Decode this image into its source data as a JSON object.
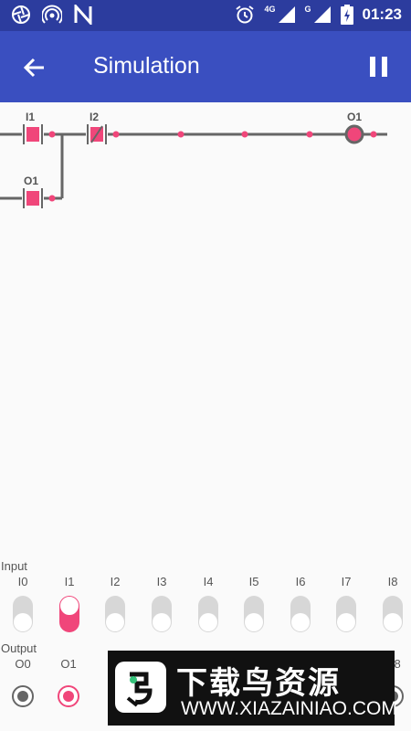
{
  "status_bar": {
    "time": "01:23",
    "net_label_1": "4G",
    "net_label_2": "G",
    "icons": [
      "aperture-icon",
      "hotspot-icon",
      "n-icon",
      "alarm-icon",
      "signal-icon",
      "battery-charging-icon"
    ]
  },
  "app_bar": {
    "title": "Simulation",
    "back_icon": "arrow-back-icon",
    "pause_icon": "pause-icon"
  },
  "ladder": {
    "rung1": {
      "contact1": "I1",
      "contact2": "I2",
      "coil": "O1"
    },
    "rung2": {
      "contact1": "O1"
    }
  },
  "inputs": {
    "label": "Input",
    "items": [
      {
        "name": "I0",
        "on": false
      },
      {
        "name": "I1",
        "on": true
      },
      {
        "name": "I2",
        "on": false
      },
      {
        "name": "I3",
        "on": false
      },
      {
        "name": "I4",
        "on": false
      },
      {
        "name": "I5",
        "on": false
      },
      {
        "name": "I6",
        "on": false
      },
      {
        "name": "I7",
        "on": false
      },
      {
        "name": "I8",
        "on": false
      }
    ]
  },
  "outputs": {
    "label": "Output",
    "items": [
      {
        "name": "O0",
        "on": false
      },
      {
        "name": "O1",
        "on": true
      },
      {
        "name": "O8",
        "on": false
      }
    ]
  },
  "watermark": {
    "text_cn": "下载鸟资源",
    "url": "WWW.XIAZAINIAO.COM"
  },
  "colors": {
    "status_bar": "#2c3c9e",
    "app_bar": "#3a4fc0",
    "accent": "#f0467a",
    "wire": "#666666"
  }
}
